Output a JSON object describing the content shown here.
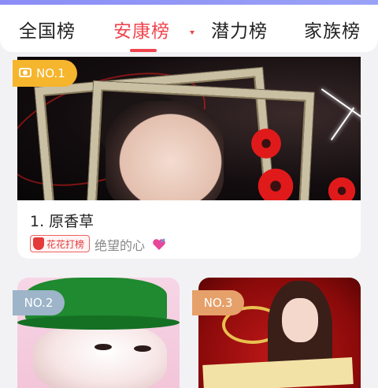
{
  "tabs": [
    {
      "label": "全国榜",
      "active": false
    },
    {
      "label": "安康榜",
      "active": true
    },
    {
      "label": "潜力榜",
      "active": false
    },
    {
      "label": "家族榜",
      "active": false
    }
  ],
  "colors": {
    "accent": "#f0454f",
    "gold_badge": "#f5b52d",
    "silver_badge": "#9db4c9",
    "bronze_badge": "#e6a06a"
  },
  "top1": {
    "rank_badge": "NO.1",
    "rank_icon": "camera-icon",
    "name": "1. 原香草",
    "tag_label": "花花打榜",
    "subtitle": "绝望的心",
    "subtitle_icon": "heart-icon"
  },
  "top2": {
    "rank_badge": "NO.2"
  },
  "top3": {
    "rank_badge": "NO.3"
  }
}
